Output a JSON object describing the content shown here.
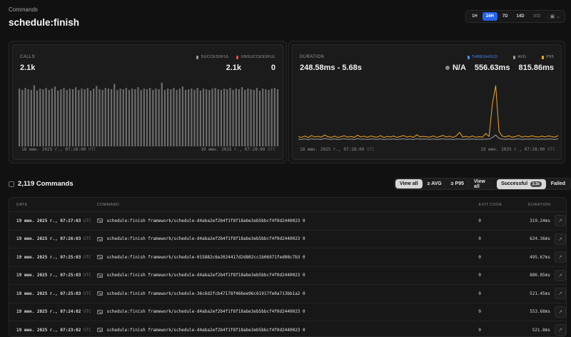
{
  "breadcrumb": "Commands",
  "page_title": "schedule:finish",
  "periods": [
    {
      "label": "1H",
      "state": "normal"
    },
    {
      "label": "24H",
      "state": "active"
    },
    {
      "label": "7D",
      "state": "normal"
    },
    {
      "label": "14D",
      "state": "normal"
    },
    {
      "label": "30D",
      "state": "disabled"
    }
  ],
  "calendar_icon": "calendar-icon",
  "calls_card": {
    "label": "CALLS",
    "value": "2.1k",
    "legend_successful": "SUCCESSFUL",
    "legend_unsuccessful": "UNSUCCESSFUL",
    "successful_value": "2.1k",
    "unsuccessful_value": "0",
    "start_time": "18 июн. 2025 г., 07:28:00",
    "end_time": "19 июн. 2025 г., 07:28:00",
    "tz": "UTC",
    "colors": {
      "successful": "#9a9a9a",
      "unsuccessful": "#e5484d",
      "bar": "#6b6b6b"
    }
  },
  "duration_card": {
    "label": "DURATION",
    "value": "248.58ms - 5.68s",
    "legend_threshold": "THRESHOLD",
    "legend_avg": "AVG",
    "legend_p95": "P95",
    "threshold_value": "N/A",
    "avg_value": "556.63ms",
    "p95_value": "815.86ms",
    "start_time": "18 июн. 2025 г., 07:28:00",
    "end_time": "19 июн. 2025 г., 07:28:00",
    "tz": "UTC",
    "colors": {
      "threshold": "#4f8cff",
      "avg": "#9a9a9a",
      "p95": "#f5a623"
    }
  },
  "chart_data": [
    {
      "type": "bar",
      "title": "",
      "series": [
        {
          "name": "SUCCESSFUL",
          "values": [
            88,
            86,
            89,
            87,
            86,
            93,
            85,
            88,
            87,
            89,
            86,
            88,
            91,
            85,
            87,
            89,
            86,
            88,
            87,
            90,
            86,
            88,
            87,
            89,
            85,
            88,
            92,
            87,
            86,
            89,
            88,
            87,
            95,
            86,
            88,
            87,
            89,
            86,
            88,
            87,
            90,
            86,
            88,
            87,
            89,
            86,
            88,
            87,
            97,
            86,
            88,
            87,
            89,
            86,
            88,
            91,
            86,
            87,
            88,
            86,
            89,
            85,
            88,
            87,
            86,
            88,
            89,
            87,
            86,
            88,
            87,
            89,
            86,
            88,
            87,
            90,
            86,
            88,
            87,
            86,
            89,
            85,
            88,
            87,
            86,
            88,
            89,
            87
          ]
        }
      ]
    },
    {
      "type": "line",
      "title": "",
      "series": [
        {
          "name": "AVG",
          "values": [
            0.55,
            0.52,
            0.58,
            0.5,
            0.6,
            0.54,
            0.56,
            0.52,
            0.62,
            0.55,
            0.53,
            0.57,
            0.51,
            0.55,
            0.59,
            0.53,
            0.56,
            0.52,
            0.61,
            0.54,
            0.56,
            0.52,
            0.57,
            0.55,
            0.53,
            0.58,
            0.51,
            0.56,
            0.54,
            0.57,
            0.52,
            0.55,
            0.58,
            0.53,
            0.56,
            0.52,
            0.59,
            0.54,
            0.56,
            0.55,
            0.53,
            0.57,
            0.52,
            0.55,
            0.58,
            0.54,
            0.56,
            0.52,
            0.57,
            0.55,
            0.53,
            0.56,
            0.54,
            0.57,
            0.52,
            0.55,
            0.53,
            0.56,
            0.55,
            0.7,
            0.95,
            0.62,
            0.56,
            0.53,
            0.57,
            0.52,
            0.55,
            0.58,
            0.53,
            0.56,
            0.54,
            0.57,
            0.55,
            0.53,
            0.56,
            0.54,
            0.57,
            0.55,
            0.53,
            0.58
          ]
        },
        {
          "name": "P95",
          "values": [
            0.78,
            0.72,
            0.85,
            0.7,
            0.9,
            0.76,
            0.82,
            0.74,
            0.95,
            0.78,
            0.73,
            0.84,
            0.71,
            0.79,
            0.88,
            0.74,
            0.81,
            0.72,
            0.92,
            0.77,
            0.83,
            0.73,
            0.86,
            0.78,
            0.74,
            0.89,
            0.71,
            0.82,
            0.76,
            0.85,
            0.72,
            0.79,
            0.9,
            0.74,
            0.83,
            0.72,
            0.96,
            0.77,
            0.82,
            0.78,
            0.74,
            0.86,
            0.72,
            0.79,
            0.91,
            0.75,
            0.83,
            0.73,
            0.85,
            1.2,
            0.76,
            0.82,
            0.74,
            0.86,
            0.72,
            0.79,
            0.74,
            1.1,
            0.81,
            3.9,
            5.68,
            1.3,
            0.84,
            0.76,
            0.88,
            0.73,
            0.8,
            0.91,
            0.74,
            0.83,
            0.76,
            0.87,
            0.79,
            0.75,
            0.84,
            0.77,
            0.86,
            0.8,
            0.74,
            0.89
          ]
        }
      ]
    }
  ],
  "commands": {
    "count_label": "2,119 Commands",
    "filter_duration": [
      "View all",
      "≥ AVG",
      "≥ P95"
    ],
    "filter_duration_selected": 0,
    "filter_status": {
      "view_all": "View all",
      "successful": "Successful",
      "successful_count": "2.1k",
      "failed": "Failed"
    },
    "columns": {
      "date": "DATE",
      "command": "COMMAND",
      "exit_code": "EXIT CODE",
      "duration": "DURATION"
    },
    "rows": [
      {
        "date": "19 июн. 2025 г., 07:27:03",
        "tz": "UTC",
        "command": "schedule:finish framework/schedule-d4aba2ef2b4f1f8f18abe3eb5bbcf4f0d2440023 0",
        "exit_code": "0",
        "duration": "319.24ms"
      },
      {
        "date": "19 июн. 2025 г., 07:26:03",
        "tz": "UTC",
        "command": "schedule:finish framework/schedule-d4aba2ef2b4f1f8f18abe3eb5bbcf4f0d2440023 0",
        "exit_code": "0",
        "duration": "624.36ms"
      },
      {
        "date": "19 июн. 2025 г., 07:25:03",
        "tz": "UTC",
        "command": "schedule:finish framework/schedule-015882c6e2024417d2d802cc1b06971fed08c7b3 0",
        "exit_code": "0",
        "duration": "495.67ms"
      },
      {
        "date": "19 июн. 2025 г., 07:25:03",
        "tz": "UTC",
        "command": "schedule:finish framework/schedule-d4aba2ef2b4f1f8f18abe3eb5bbcf4f0d2440023 0",
        "exit_code": "0",
        "duration": "886.85ms"
      },
      {
        "date": "19 июн. 2025 г., 07:25:03",
        "tz": "UTC",
        "command": "schedule:finish framework/schedule-36c6d2fcb47178f466ee96c61917fe0a713bb1a2 0",
        "exit_code": "0",
        "duration": "521.45ms"
      },
      {
        "date": "19 июн. 2025 г., 07:24:02",
        "tz": "UTC",
        "command": "schedule:finish framework/schedule-d4aba2ef2b4f1f8f18abe3eb5bbcf4f0d2440023 0",
        "exit_code": "0",
        "duration": "553.68ms"
      },
      {
        "date": "19 июн. 2025 г., 07:23:02",
        "tz": "UTC",
        "command": "schedule:finish framework/schedule-d4aba2ef2b4f1f8f18abe3eb5bbcf4f0d2440023 0",
        "exit_code": "0",
        "duration": "521.8ms"
      }
    ]
  }
}
